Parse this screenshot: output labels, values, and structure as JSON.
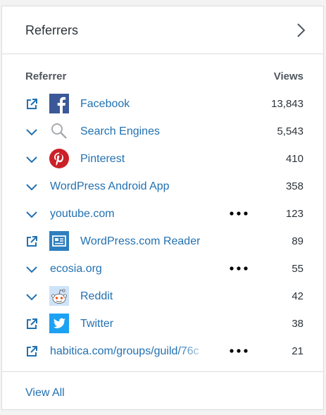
{
  "card": {
    "title": "Referrers",
    "column_referrer": "Referrer",
    "column_views": "Views",
    "view_all": "View All"
  },
  "colors": {
    "link": "#2271b1",
    "text": "#2c3338",
    "border": "#dcdcde",
    "facebook": "#3b5998",
    "pinterest": "#cb2027",
    "twitter": "#1da1f2",
    "reader": "#2e7fbf"
  },
  "rows": [
    {
      "label": "Facebook",
      "views": "13,843",
      "lead": "external-link-icon",
      "icon": "facebook-icon"
    },
    {
      "label": "Search Engines",
      "views": "5,543",
      "lead": "chevron-down-icon",
      "icon": "search-icon"
    },
    {
      "label": "Pinterest",
      "views": "410",
      "lead": "chevron-down-icon",
      "icon": "pinterest-icon"
    },
    {
      "label": "WordPress Android App",
      "views": "358",
      "lead": "chevron-down-icon",
      "icon": ""
    },
    {
      "label": "youtube.com",
      "views": "123",
      "lead": "chevron-down-icon",
      "icon": "",
      "more": "ellipsis-icon"
    },
    {
      "label": "WordPress.com Reader",
      "views": "89",
      "lead": "external-link-icon",
      "icon": "reader-icon"
    },
    {
      "label": "ecosia.org",
      "views": "55",
      "lead": "chevron-down-icon",
      "icon": "",
      "more": "ellipsis-icon"
    },
    {
      "label": "Reddit",
      "views": "42",
      "lead": "chevron-down-icon",
      "icon": "reddit-icon"
    },
    {
      "label": "Twitter",
      "views": "38",
      "lead": "external-link-icon",
      "icon": "twitter-icon"
    },
    {
      "label": "habitica.com/groups/guild/76c",
      "views": "21",
      "lead": "external-link-icon",
      "icon": "",
      "more": "ellipsis-icon"
    }
  ]
}
